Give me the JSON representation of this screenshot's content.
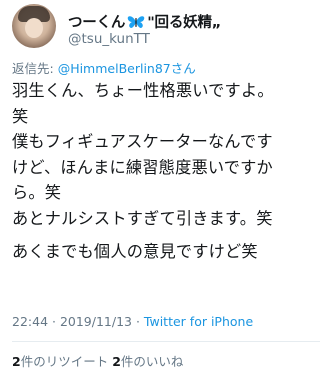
{
  "user": {
    "name_prefix": "つーくん",
    "name_suffix": "\"回る妖精„",
    "handle": "@tsu_kunTT"
  },
  "reply": {
    "label": "返信先: ",
    "target": "@HimmelBerlin87さん"
  },
  "tweet": {
    "lines": [
      "羽生くん、ちょー性格悪いですよ。",
      "笑",
      "僕もフィギュアスケーターなんです",
      "けど、ほんまに練習態度悪いですか",
      "ら。笑",
      "あとナルシストすぎて引きます。笑",
      "あくまでも個人の意見ですけど笑"
    ]
  },
  "meta": {
    "time": "22:44",
    "separator": " · ",
    "date": "2019/11/13",
    "source": "Twitter for iPhone"
  },
  "stats": {
    "retweets_count": "2",
    "retweets_label": "件のリツイート",
    "likes_count": "2",
    "likes_label": "件のいいね"
  },
  "colors": {
    "link": "#1b95e0",
    "secondary_text": "#657786",
    "butterfly": "#1da1f2"
  },
  "icons": {
    "name_emoji": "butterfly-icon"
  }
}
